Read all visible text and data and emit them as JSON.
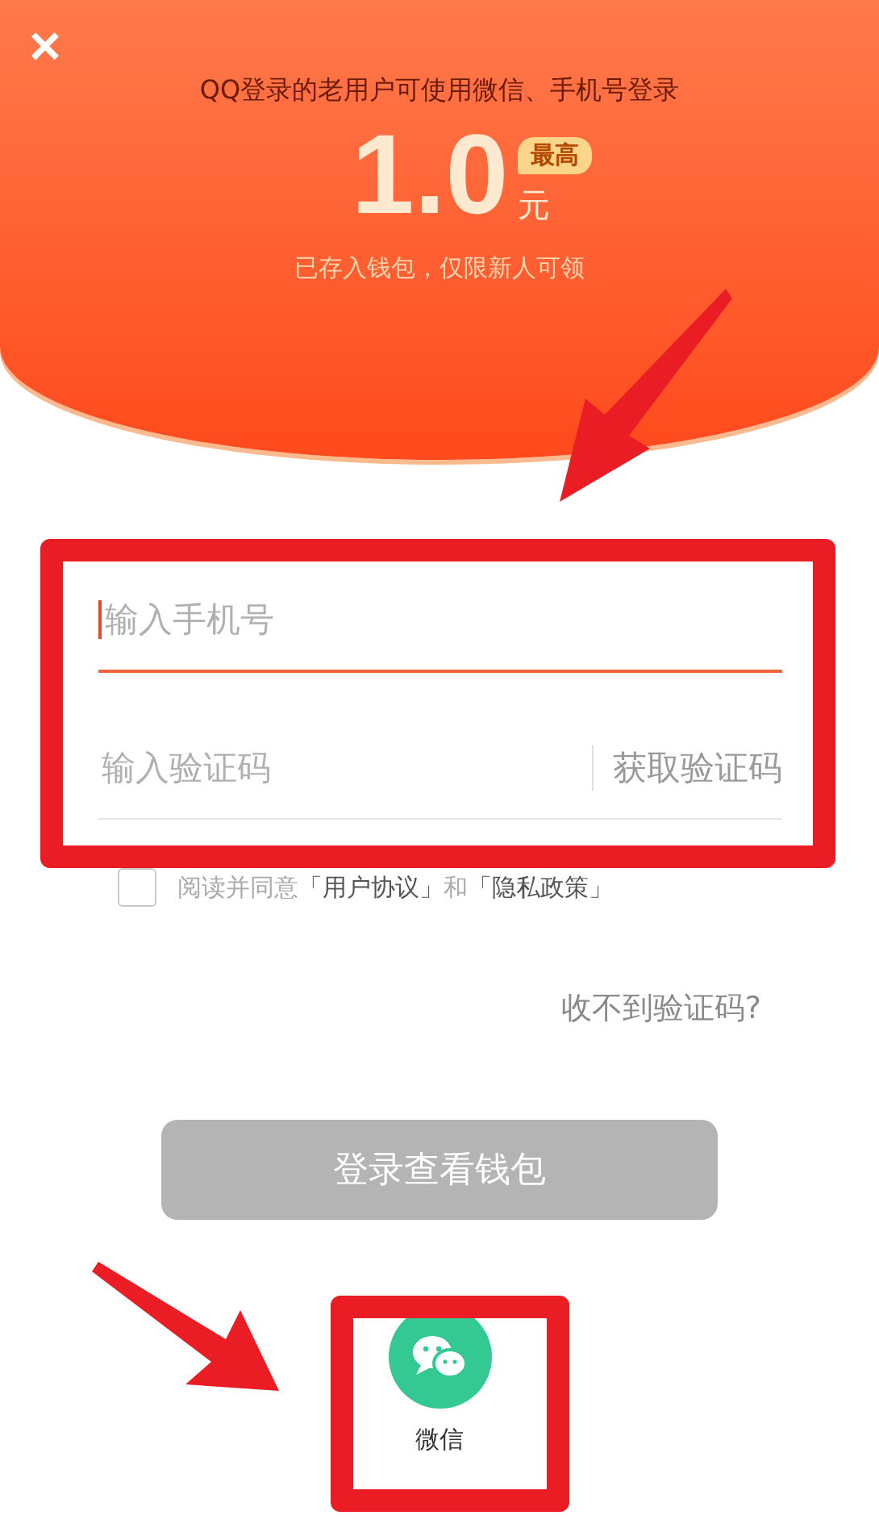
{
  "header": {
    "close": "×",
    "subtitle": "QQ登录的老用户可使用微信、手机号登录",
    "amount": "1.0",
    "unit": "元",
    "badge": "最高",
    "note": "已存入钱包，仅限新人可领"
  },
  "fields": [
    {
      "placeholder": "输入手机号",
      "focused": true
    },
    {
      "placeholder": "输入验证码",
      "focused": false,
      "action": "获取验证码"
    }
  ],
  "agreement": {
    "checked": false,
    "parts": [
      {
        "text": "阅读并同意",
        "kind": "plain"
      },
      {
        "text": "「用户协议」",
        "kind": "link"
      },
      {
        "text": "和",
        "kind": "plain"
      },
      {
        "text": "「隐私政策」",
        "kind": "link"
      }
    ]
  },
  "help_link": "收不到验证码?",
  "login_button": {
    "label": "登录查看钱包",
    "disabled": true
  },
  "alt_logins": [
    {
      "label": "微信"
    }
  ]
}
